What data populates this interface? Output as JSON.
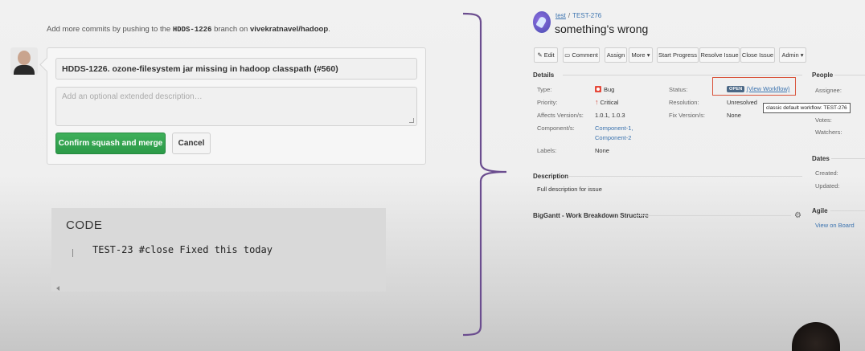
{
  "github": {
    "hint_prefix": "Add more commits by pushing to the",
    "branch": "HDDS-1226",
    "hint_middle": "branch on",
    "repo": "vivekratnavel/hadoop",
    "hint_suffix": ".",
    "commit_title": "HDDS-1226. ozone-filesystem jar missing in hadoop classpath (#560)",
    "description_placeholder": "Add an optional extended description…",
    "confirm_label": "Confirm squash and merge",
    "cancel_label": "Cancel"
  },
  "code_block": {
    "title": "CODE",
    "line": "TEST-23 #close Fixed this today"
  },
  "jira": {
    "breadcrumb": {
      "project": "test",
      "issue_key": "TEST-276"
    },
    "summary": "something's wrong",
    "toolbar": {
      "edit": "Edit",
      "comment": "Comment",
      "assign": "Assign",
      "more": "More",
      "start_progress": "Start Progress",
      "resolve_issue": "Resolve Issue",
      "close_issue": "Close Issue",
      "admin": "Admin"
    },
    "details": {
      "heading": "Details",
      "type_label": "Type:",
      "type_value": "Bug",
      "priority_label": "Priority:",
      "priority_value": "Critical",
      "affects_label": "Affects Version/s:",
      "affects_value": "1.0.1, 1.0.3",
      "components_label": "Component/s:",
      "components": [
        "Component-1,",
        "Component-2"
      ],
      "labels_label": "Labels:",
      "labels_value": "None",
      "status_label": "Status:",
      "status_value": "OPEN",
      "view_workflow": "(View Workflow)",
      "resolution_label": "Resolution:",
      "resolution_value": "Unresolved",
      "fix_label": "Fix Version/s:",
      "fix_value": "None",
      "tooltip": "classic default workflow: TEST-276"
    },
    "description": {
      "heading": "Description",
      "text": "Full description for issue"
    },
    "bigganttt": {
      "heading": "BigGantt - Work Breakdown Structure"
    },
    "people": {
      "heading": "People",
      "assignee_label": "Assignee:",
      "votes_label": "Votes:",
      "watchers_label": "Watchers:"
    },
    "dates": {
      "heading": "Dates",
      "created_label": "Created:",
      "updated_label": "Updated:"
    },
    "agile": {
      "heading": "Agile",
      "view_on_board": "View on Board"
    }
  },
  "colors": {
    "merge_green": "#2c9a48",
    "jira_link": "#3b73af",
    "status_lozenge": "#4a6785",
    "highlight_red": "#d9543c",
    "bracket_purple": "#6b4d8f"
  }
}
